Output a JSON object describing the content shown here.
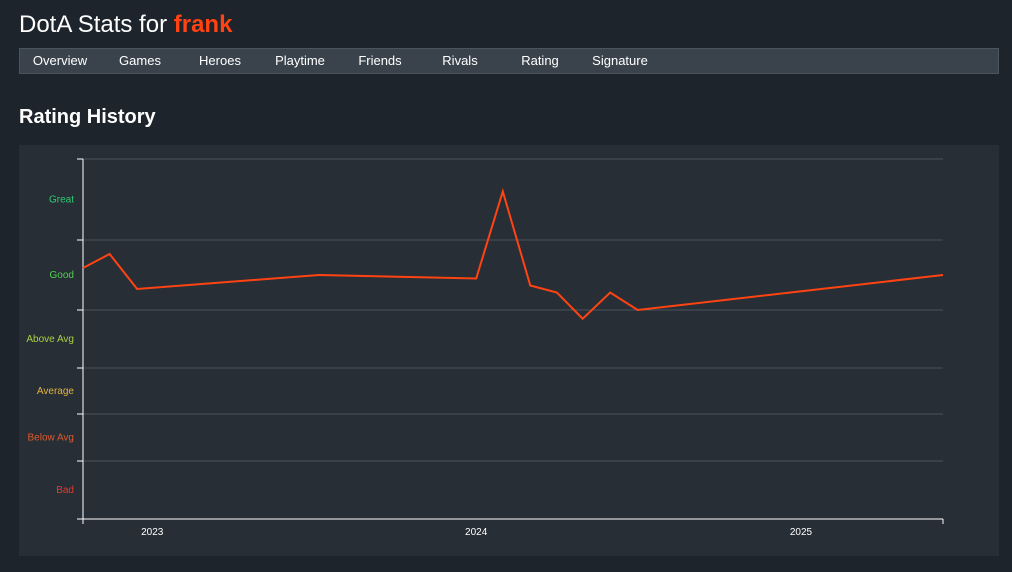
{
  "header": {
    "title_prefix": "DotA Stats for ",
    "username": "frank"
  },
  "nav": {
    "items": [
      {
        "label": "Overview",
        "name": "nav-overview"
      },
      {
        "label": "Games",
        "name": "nav-games"
      },
      {
        "label": "Heroes",
        "name": "nav-heroes"
      },
      {
        "label": "Playtime",
        "name": "nav-playtime"
      },
      {
        "label": "Friends",
        "name": "nav-friends"
      },
      {
        "label": "Rivals",
        "name": "nav-rivals"
      },
      {
        "label": "Rating",
        "name": "nav-rating"
      },
      {
        "label": "Signature",
        "name": "nav-signature"
      }
    ]
  },
  "section": {
    "title": "Rating History"
  },
  "chart_data": {
    "type": "line",
    "title": "",
    "xlabel": "",
    "ylabel": "",
    "xlim": [
      "2022-10-15",
      "2025-06-10"
    ],
    "ylim": [
      0,
      6
    ],
    "x_ticks": [
      "2023",
      "2024",
      "2025"
    ],
    "y_bands": [
      {
        "label": "Bad",
        "from": 0,
        "to": 1,
        "color": "#e03b2c"
      },
      {
        "label": "Below Avg",
        "from": 1,
        "to": 2,
        "color": "#e0592c"
      },
      {
        "label": "Average",
        "from": 2,
        "to": 3,
        "color": "#e3b341"
      },
      {
        "label": "Above Avg",
        "from": 3,
        "to": 4,
        "color": "#a9d13f"
      },
      {
        "label": "Good",
        "from": 4,
        "to": 5,
        "color": "#4ed14e"
      },
      {
        "label": "Great",
        "from": 5,
        "to": 6,
        "color": "#2ecc71"
      }
    ],
    "grid": true,
    "line_color": "#ff4312",
    "series": [
      {
        "x": [
          "2022-10-15",
          "2022-11-14",
          "2022-12-15",
          "2023-07-08",
          "2024-01-01",
          "2024-01-31",
          "2024-03-02",
          "2024-04-01",
          "2024-04-30",
          "2024-05-31",
          "2024-07-01",
          "2025-06-10"
        ],
        "values": [
          4.6,
          4.8,
          4.3,
          4.5,
          4.45,
          5.6,
          4.35,
          4.25,
          3.85,
          4.25,
          4.0,
          4.5
        ]
      }
    ]
  }
}
